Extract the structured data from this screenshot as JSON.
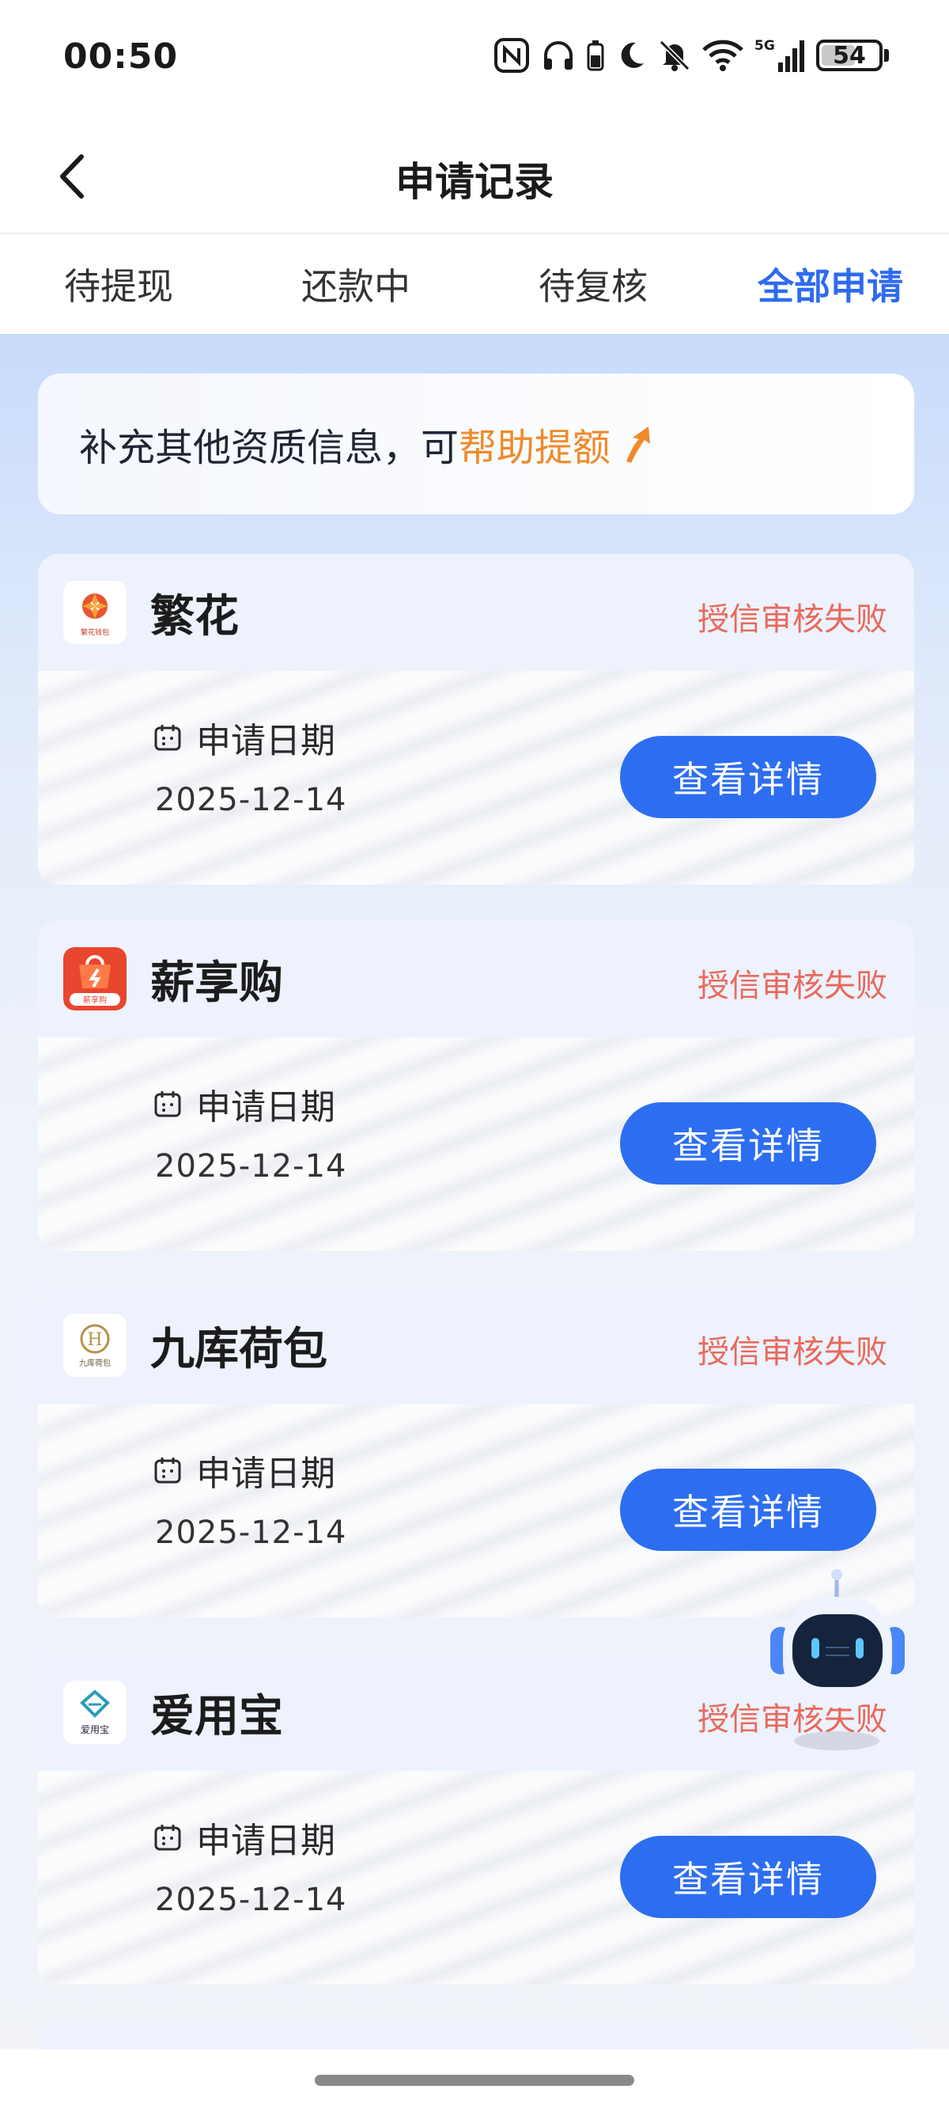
{
  "status_bar": {
    "time": "00:50",
    "battery": "54"
  },
  "nav": {
    "title": "申请记录"
  },
  "tabs": [
    {
      "label": "待提现",
      "active": false
    },
    {
      "label": "还款中",
      "active": false
    },
    {
      "label": "待复核",
      "active": false
    },
    {
      "label": "全部申请",
      "active": true
    }
  ],
  "banner": {
    "text": "补充其他资质信息，可",
    "highlight": "帮助提额"
  },
  "records": [
    {
      "name": "繁花",
      "logo_text": "繁花钱包",
      "status": "授信审核失败",
      "date_label": "申请日期",
      "date": "2025-12-14",
      "button": "查看详情"
    },
    {
      "name": "薪享购",
      "logo_text": "薪享购",
      "status": "授信审核失败",
      "date_label": "申请日期",
      "date": "2025-12-14",
      "button": "查看详情"
    },
    {
      "name": "九库荷包",
      "logo_text": "九库荷包",
      "status": "授信审核失败",
      "date_label": "申请日期",
      "date": "2025-12-14",
      "button": "查看详情"
    },
    {
      "name": "爱用宝",
      "logo_text": "爱用宝",
      "status": "授信审核失败",
      "date_label": "申请日期",
      "date": "2025-12-14",
      "button": "查看详情"
    }
  ],
  "colors": {
    "accent": "#2d6ef0",
    "status_fail": "#e86a5d",
    "highlight": "#ef8a2a"
  },
  "icons": {
    "back": "chevron-left-icon",
    "calendar": "calendar-icon",
    "arrow": "arrow-up-right-icon",
    "assistant": "robot-assistant-icon"
  }
}
